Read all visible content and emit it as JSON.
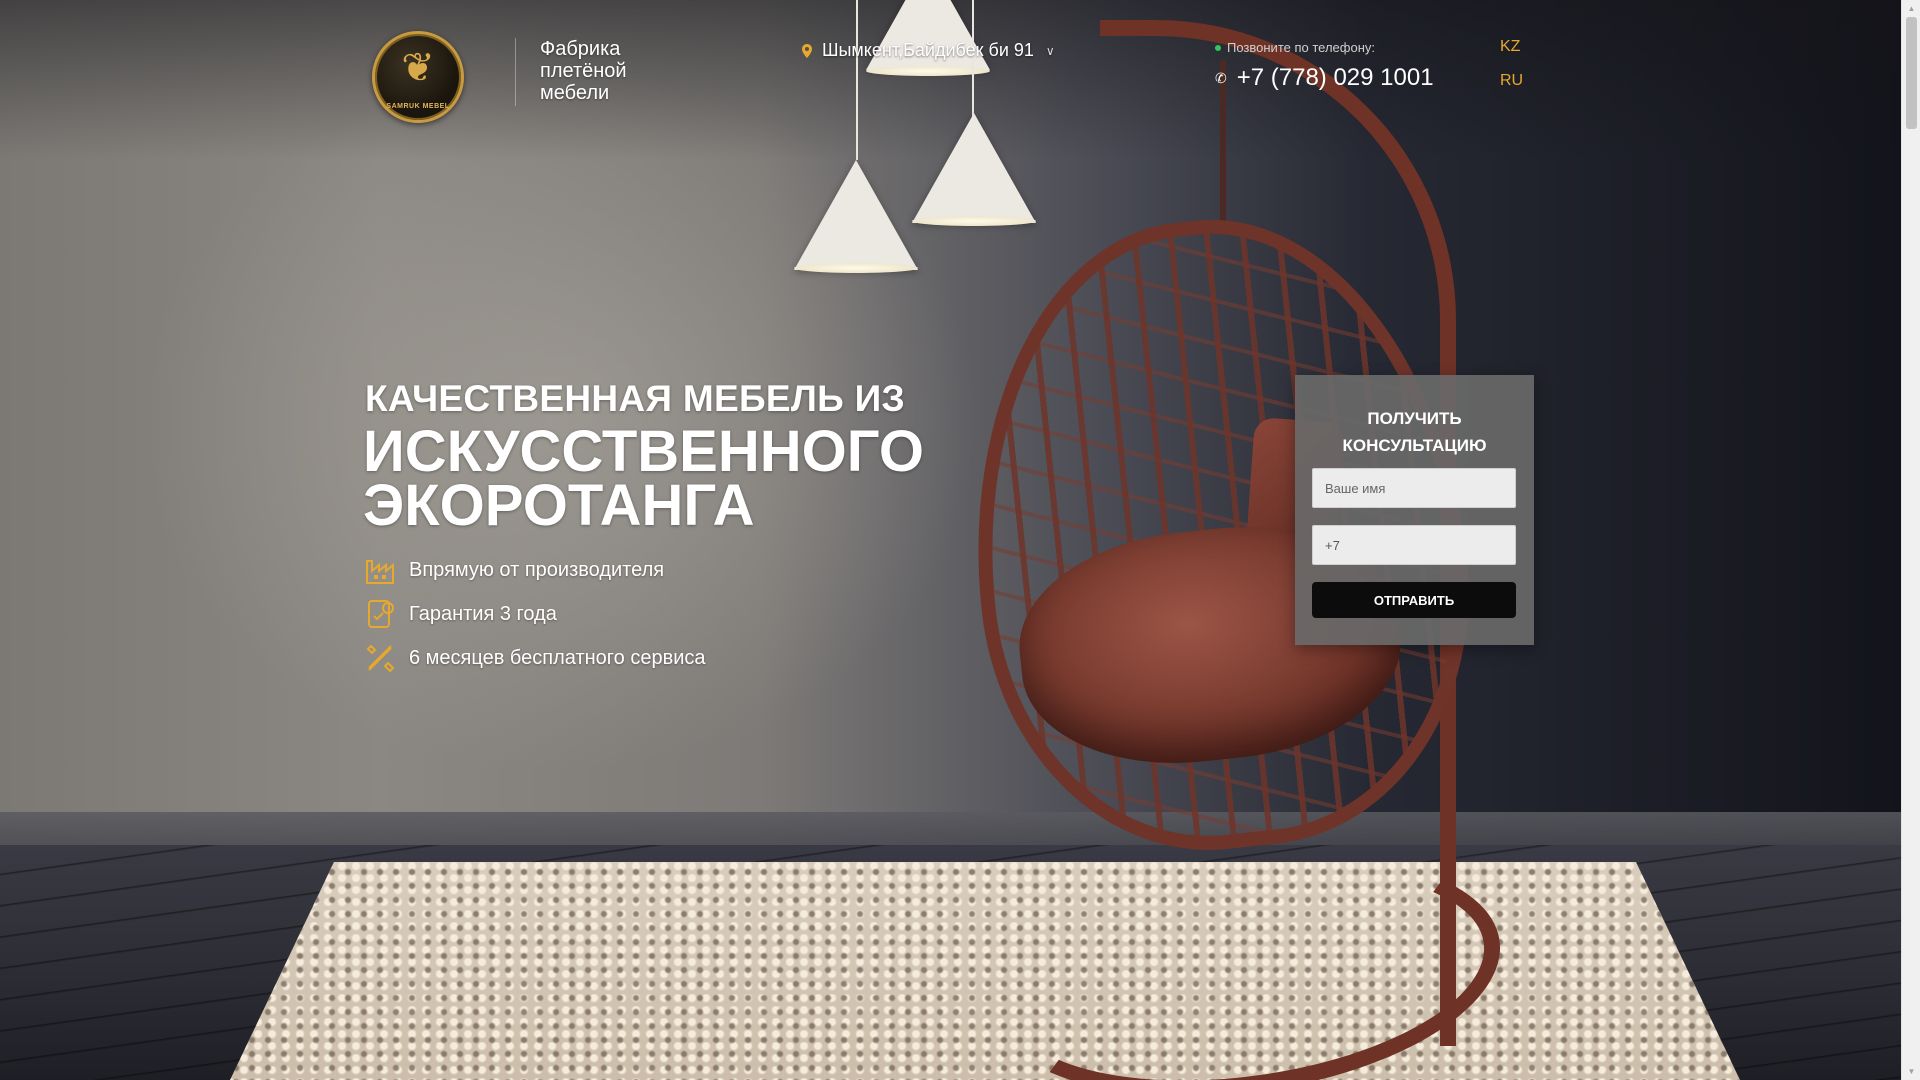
{
  "header": {
    "logo_text": "SAMRUK MEBEL",
    "tagline": "Фабрика плетёной мебели",
    "address": "Шымкент,Байдибек би 91",
    "call_label": "Позвоните по телефону:",
    "phone": "+7 (778) 029 1001",
    "languages": [
      "KZ",
      "RU"
    ]
  },
  "hero": {
    "line1": "КАЧЕСТВЕННАЯ МЕБЕЛЬ ИЗ",
    "line2": "ИСКУССТВЕННОГО ЭКОРОТАНГА",
    "features": [
      {
        "icon": "factory-icon",
        "text": "Впрямую от производителя"
      },
      {
        "icon": "guarantee-icon",
        "text": "Гарантия 3 года"
      },
      {
        "icon": "tools-icon",
        "text": "6 месяцев бесплатного сервиса"
      }
    ]
  },
  "form": {
    "title": "ПОЛУЧИТЬ КОНСУЛЬТАЦИЮ",
    "name_placeholder": "Ваше имя",
    "phone_value": "+7",
    "submit_label": "ОТПРАВИТЬ"
  },
  "colors": {
    "accent": "#e6a92c",
    "form_bg": "#696969",
    "button_bg": "#0c0c0c",
    "online_dot": "#35c35d"
  }
}
